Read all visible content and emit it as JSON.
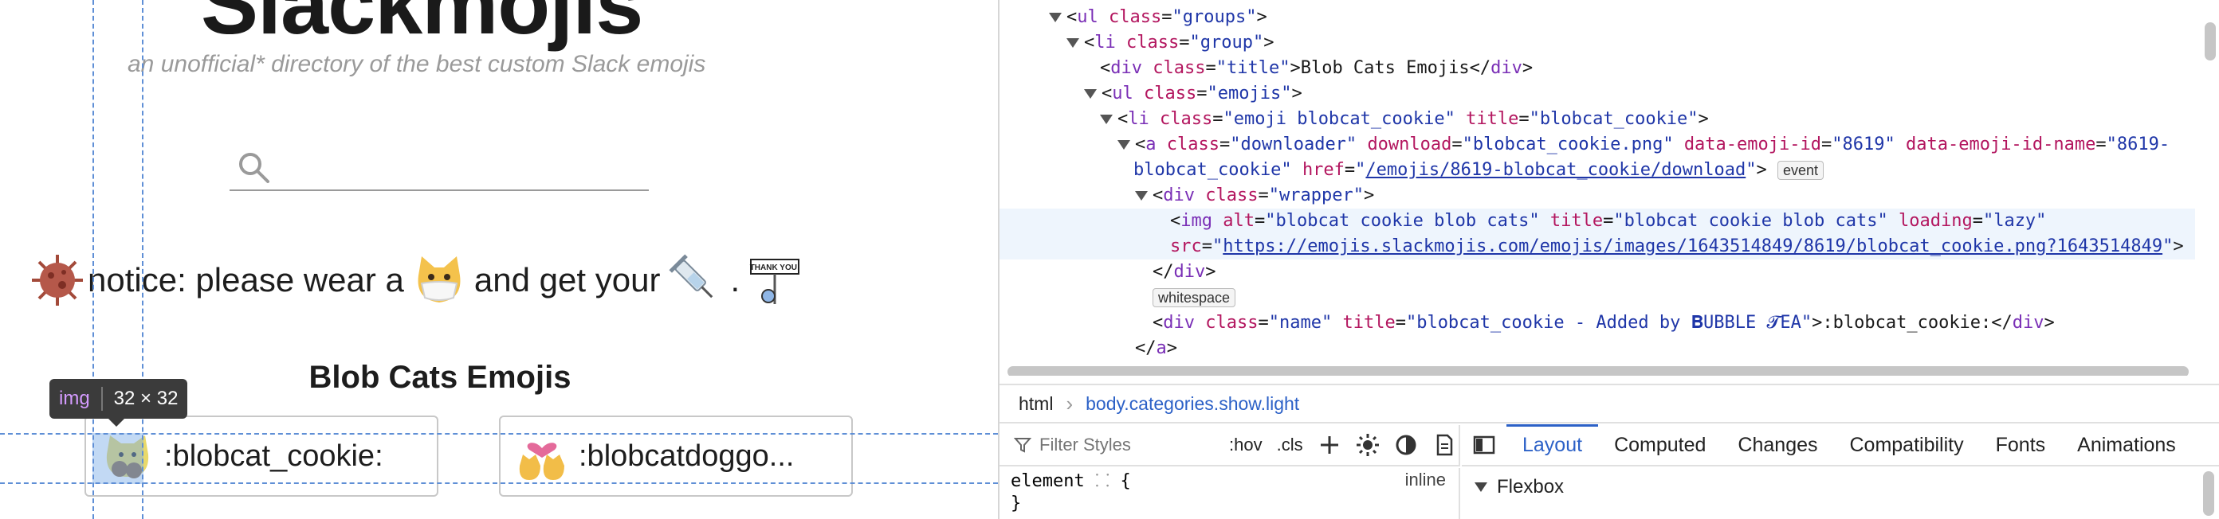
{
  "site": {
    "title": "Slackmojis",
    "subtitle": "an unofficial* directory of the best custom Slack emojis",
    "search": {
      "value": "",
      "placeholder": ""
    }
  },
  "notice": {
    "text_1": "notice: please wear a",
    "text_2": "and get your",
    "text_3": ".",
    "sign_text": "THANK YOU!"
  },
  "group": {
    "title": "Blob Cats Emojis",
    "emojis": [
      {
        "name": ":blobcat_cookie:"
      },
      {
        "name": ":blobcatdoggo..."
      }
    ]
  },
  "inspector_tooltip": {
    "tag": "img",
    "size": "32 × 32"
  },
  "devtools": {
    "markup": {
      "l1": {
        "open": "<",
        "tag": "ul",
        "attr": "class",
        "eq": "=",
        "val": "\"groups\"",
        "close": ">"
      },
      "l2": {
        "open": "<",
        "tag": "li",
        "attr": "class",
        "eq": "=",
        "val": "\"group\"",
        "close": ">"
      },
      "l3": {
        "open": "<",
        "tag": "div",
        "attr": "class",
        "eq": "=",
        "val": "\"title\"",
        "close": ">",
        "text": "Blob Cats Emojis",
        "end": "</",
        "end_tag": "div",
        "end_close": ">"
      },
      "l4": {
        "open": "<",
        "tag": "ul",
        "attr": "class",
        "eq": "=",
        "val": "\"emojis\"",
        "close": ">"
      },
      "l5": {
        "open": "<",
        "tag": "li",
        "attr1": "class",
        "eq": "=",
        "val1": "\"emoji blobcat_cookie\"",
        "attr2": "title",
        "val2": "\"blobcat_cookie\"",
        "close": ">"
      },
      "l6": {
        "open": "<",
        "tag": "a",
        "attr1": "class",
        "eq": "=",
        "val1": "\"downloader\"",
        "attr2": "download",
        "val2": "\"blobcat_cookie.png\"",
        "attr3": "data-emoji-id",
        "val3": "\"8619\"",
        "attr4": "data-emoji-id-name",
        "val4": "\"8619-"
      },
      "l7": {
        "val4b": "blobcat_cookie\"",
        "attr5": "href",
        "eq": "=",
        "q1": "\"",
        "link": "/emojis/8619-blobcat_cookie/download",
        "q2": "\"",
        "close": ">",
        "badge": "event"
      },
      "l8": {
        "open": "<",
        "tag": "div",
        "attr": "class",
        "eq": "=",
        "val": "\"wrapper\"",
        "close": ">"
      },
      "l9": {
        "open": "<",
        "tag": "img",
        "attr1": "alt",
        "eq": "=",
        "val1": "\"blobcat cookie blob cats\"",
        "attr2": "title",
        "val2": "\"blobcat cookie blob cats\"",
        "attr3": "loading",
        "val3": "\"lazy\""
      },
      "l10": {
        "attr": "src",
        "eq": "=",
        "q1": "\"",
        "link": "https://emojis.slackmojis.com/emojis/images/1643514849/8619/blobcat_cookie.png?1643514849",
        "q2": "\"",
        "close": ">"
      },
      "l11": {
        "end": "</",
        "tag": "div",
        "close": ">"
      },
      "l12": {
        "badge": "whitespace"
      },
      "l13": {
        "open": "<",
        "tag": "div",
        "attr1": "class",
        "eq": "=",
        "val1": "\"name\"",
        "attr2": "title",
        "val2": "\"blobcat_cookie - Added by 𝐁UBBLE 𝓣EA\"",
        "close": ">",
        "text": ":blobcat_cookie:",
        "end": "</",
        "end_tag": "div",
        "end_close": ">"
      },
      "l14": {
        "end": "</",
        "tag": "a",
        "close": ">"
      }
    },
    "breadcrumb": {
      "first": "html",
      "separator": "›",
      "second": "body.categories.show.light"
    },
    "toolbar": {
      "filter_placeholder": "Filter Styles",
      "hov": ":hov",
      "cls": ".cls"
    },
    "tabs": [
      "Layout",
      "Computed",
      "Changes",
      "Compatibility",
      "Fonts",
      "Animations"
    ],
    "rules": {
      "selector": "element",
      "brace_open": "{",
      "brace_close": "}",
      "origin": "inline"
    },
    "layout": {
      "flexbox_header": "Flexbox"
    }
  },
  "colors": {
    "accent": "#2c61c7",
    "guide": "#5f8fd6",
    "tag": "#7a2fb6",
    "attr": "#b3165f",
    "value": "#1f36a8"
  }
}
